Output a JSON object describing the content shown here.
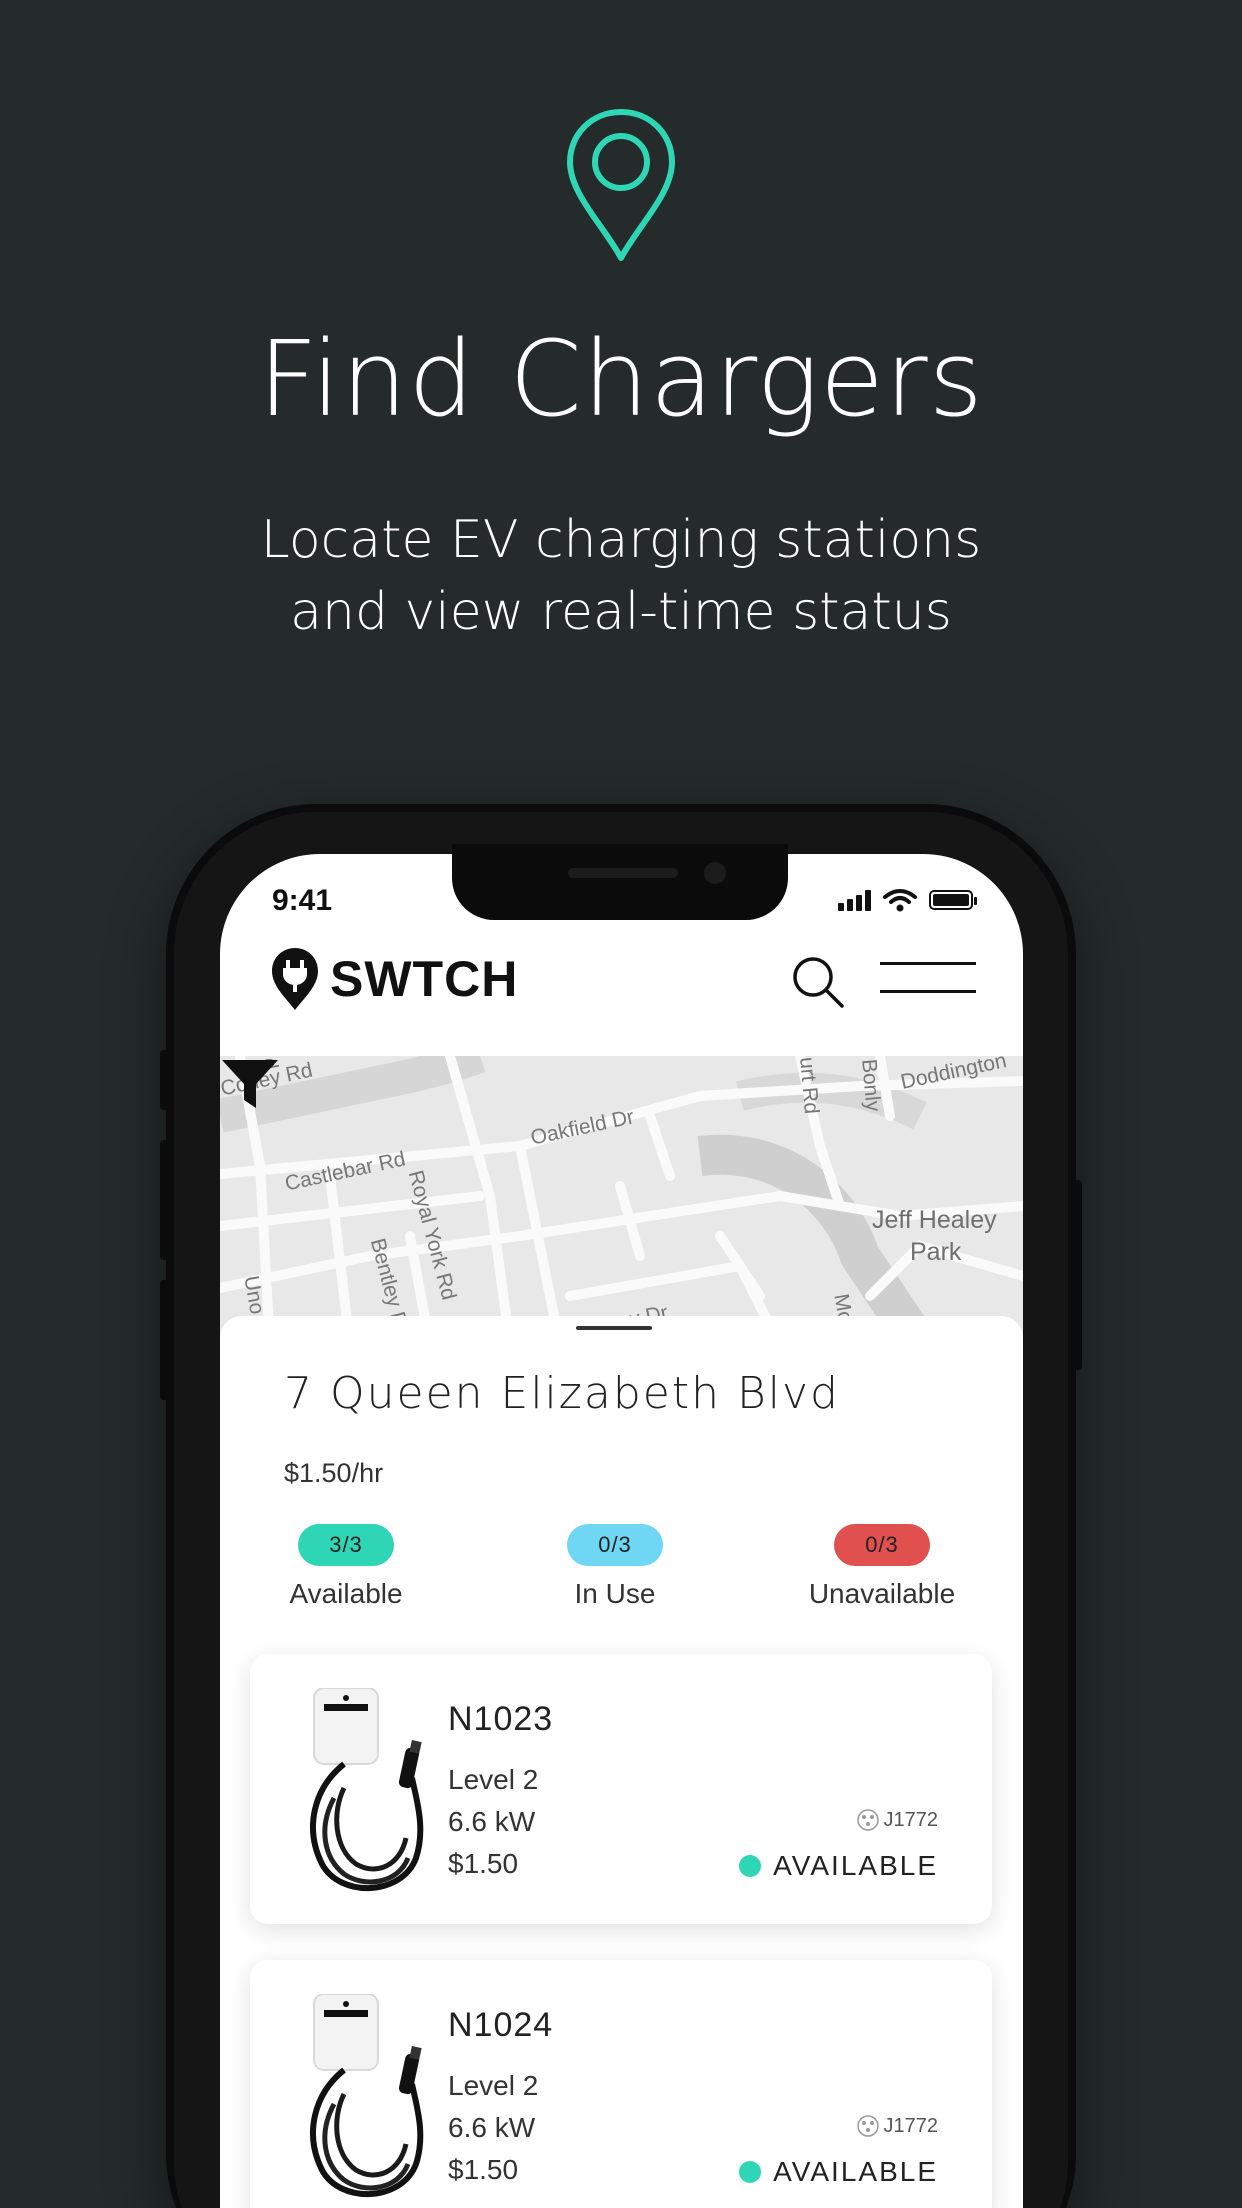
{
  "hero": {
    "title": "Find Chargers",
    "subtitle_line1": "Locate EV charging stations",
    "subtitle_line2": "and view real-time status"
  },
  "colors": {
    "background": "#242b2a",
    "accent": "#2fd6b5",
    "available": "#2fd6b5",
    "in_use": "#6fd6f3",
    "unavailable": "#e0504f"
  },
  "status_bar": {
    "time": "9:41"
  },
  "app": {
    "brand": "SWTCH"
  },
  "map": {
    "labels": [
      "Coney Rd",
      "Castlebar Rd",
      "Royal York Rd",
      "Oakfield Dr",
      "Bentley D",
      "Delroy Dr",
      "Jeff Healey",
      "Park",
      "Doddington",
      "Bonly",
      "urt Rd",
      "Uno",
      "Mc",
      "d"
    ]
  },
  "location": {
    "address": "7 Queen Elizabeth Blvd",
    "rate": "$1.50/hr",
    "stats": [
      {
        "count": "3/3",
        "label": "Available"
      },
      {
        "count": "0/3",
        "label": "In Use"
      },
      {
        "count": "0/3",
        "label": "Unavailable"
      }
    ]
  },
  "chargers": [
    {
      "id": "N1023",
      "level": "Level 2",
      "power": "6.6 kW",
      "price": "$1.50",
      "connector": "J1772",
      "status": "AVAILABLE"
    },
    {
      "id": "N1024",
      "level": "Level 2",
      "power": "6.6 kW",
      "price": "$1.50",
      "connector": "J1772",
      "status": "AVAILABLE"
    }
  ],
  "icons": [
    "location-pin-icon",
    "search-icon",
    "menu-icon",
    "filter-icon",
    "plug-icon",
    "signal-icon",
    "wifi-icon",
    "battery-icon"
  ]
}
